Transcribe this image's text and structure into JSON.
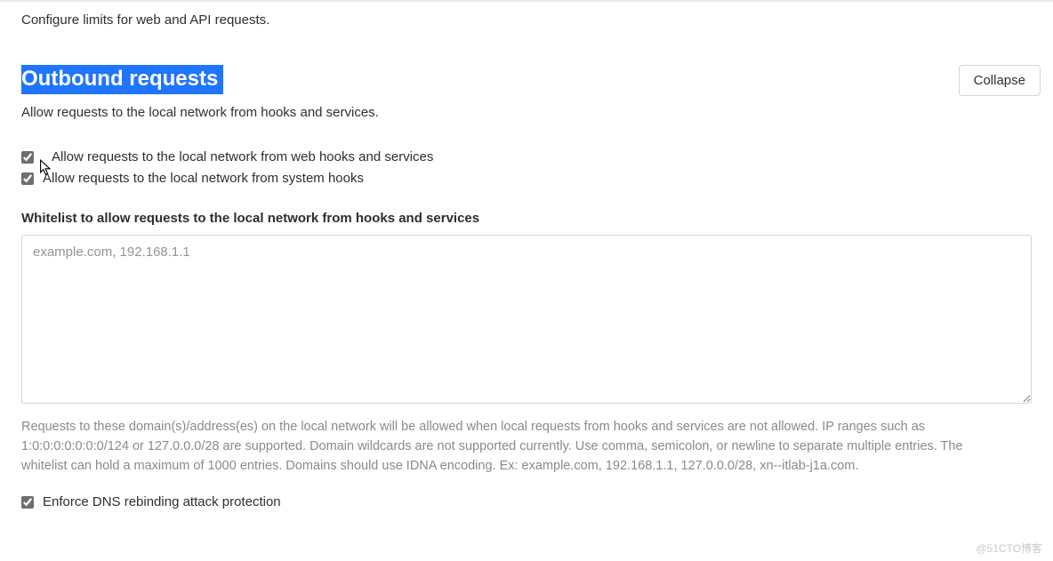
{
  "top_section": {
    "description": "Configure limits for web and API requests."
  },
  "section": {
    "title": "Outbound requests",
    "subtitle": "Allow requests to the local network from hooks and services.",
    "collapse_label": "Collapse"
  },
  "checkboxes": {
    "allow_web_hooks": {
      "label": "Allow requests to the local network from web hooks and services",
      "checked": true
    },
    "allow_system_hooks": {
      "label": "Allow requests to the local network from system hooks",
      "checked": true
    },
    "enforce_dns": {
      "label": "Enforce DNS rebinding attack protection",
      "checked": true
    }
  },
  "whitelist": {
    "label": "Whitelist to allow requests to the local network from hooks and services",
    "placeholder": "example.com, 192.168.1.1",
    "value": "",
    "help": "Requests to these domain(s)/address(es) on the local network will be allowed when local requests from hooks and services are not allowed. IP ranges such as 1:0:0:0:0:0:0:0/124 or 127.0.0.0/28 are supported. Domain wildcards are not supported currently. Use comma, semicolon, or newline to separate multiple entries. The whitelist can hold a maximum of 1000 entries. Domains should use IDNA encoding. Ex: example.com, 192.168.1.1, 127.0.0.0/28, xn--itlab-j1a.com."
  },
  "watermark": "@51CTO博客"
}
